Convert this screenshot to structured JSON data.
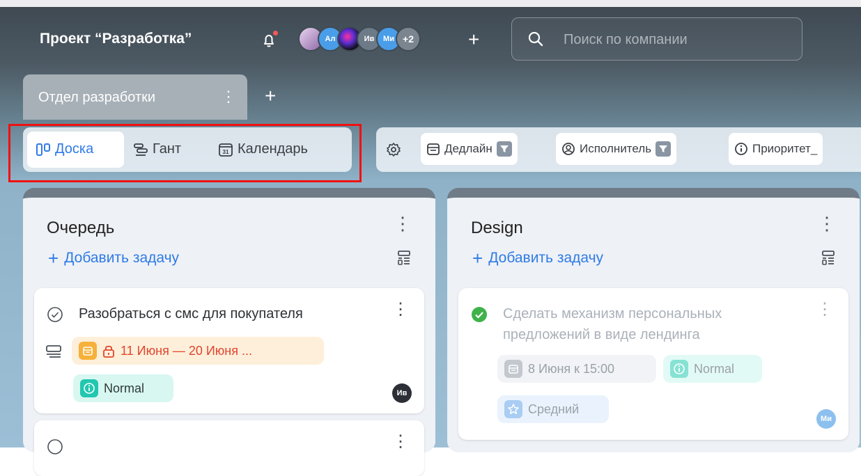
{
  "header": {
    "project_title": "Проект “Разработка”",
    "avatars": [
      {
        "initials": "",
        "color": "#c9a7d8",
        "kind": "photo"
      },
      {
        "initials": "Ал",
        "color": "#4a9de8"
      },
      {
        "initials": "",
        "color": "#2a2a3a",
        "kind": "photo"
      },
      {
        "initials": "Ив",
        "color": "#6d7a88"
      },
      {
        "initials": "Ми",
        "color": "#4a9de8"
      },
      {
        "initials": "+2",
        "color": "#7b858f"
      }
    ],
    "search_placeholder": "Поиск по компании"
  },
  "tabs": [
    {
      "label": "Отдел разработки",
      "active": true
    }
  ],
  "views": [
    {
      "label": "Доска",
      "icon": "board-icon",
      "active": true
    },
    {
      "label": "Гант",
      "icon": "gantt-icon",
      "active": false
    },
    {
      "label": "Календарь",
      "icon": "calendar-31-icon",
      "active": false
    }
  ],
  "filters": [
    {
      "label": "Дедлайн",
      "icon": "calendar-icon"
    },
    {
      "label": "Исполнитель",
      "icon": "user-circle-icon"
    },
    {
      "label": "Приоритет_",
      "icon": "info-icon"
    }
  ],
  "columns": [
    {
      "title": "Очередь",
      "add_label": "Добавить задачу",
      "cards": [
        {
          "title": "Разобраться с смс для покупателя",
          "date": "11 Июня — 20 Июня ...",
          "priority": "Normal",
          "assignee": "Ив"
        }
      ]
    },
    {
      "title": "Design",
      "add_label": "Добавить задачу",
      "cards": [
        {
          "title_line1": "Сделать механизм персональных",
          "title_line2": "предложений в виде лендинга",
          "date": "8 Июня к 15:00",
          "priority": "Normal",
          "tag": "Средний",
          "assignee": "Ми",
          "done": true
        }
      ]
    }
  ],
  "colors": {
    "accent": "#2f7be6",
    "highlight_frame": "#ef1111",
    "date_warning_bg": "#fdefd9",
    "priority_bg": "#d8f7f1",
    "done_green": "#3fb24a"
  }
}
